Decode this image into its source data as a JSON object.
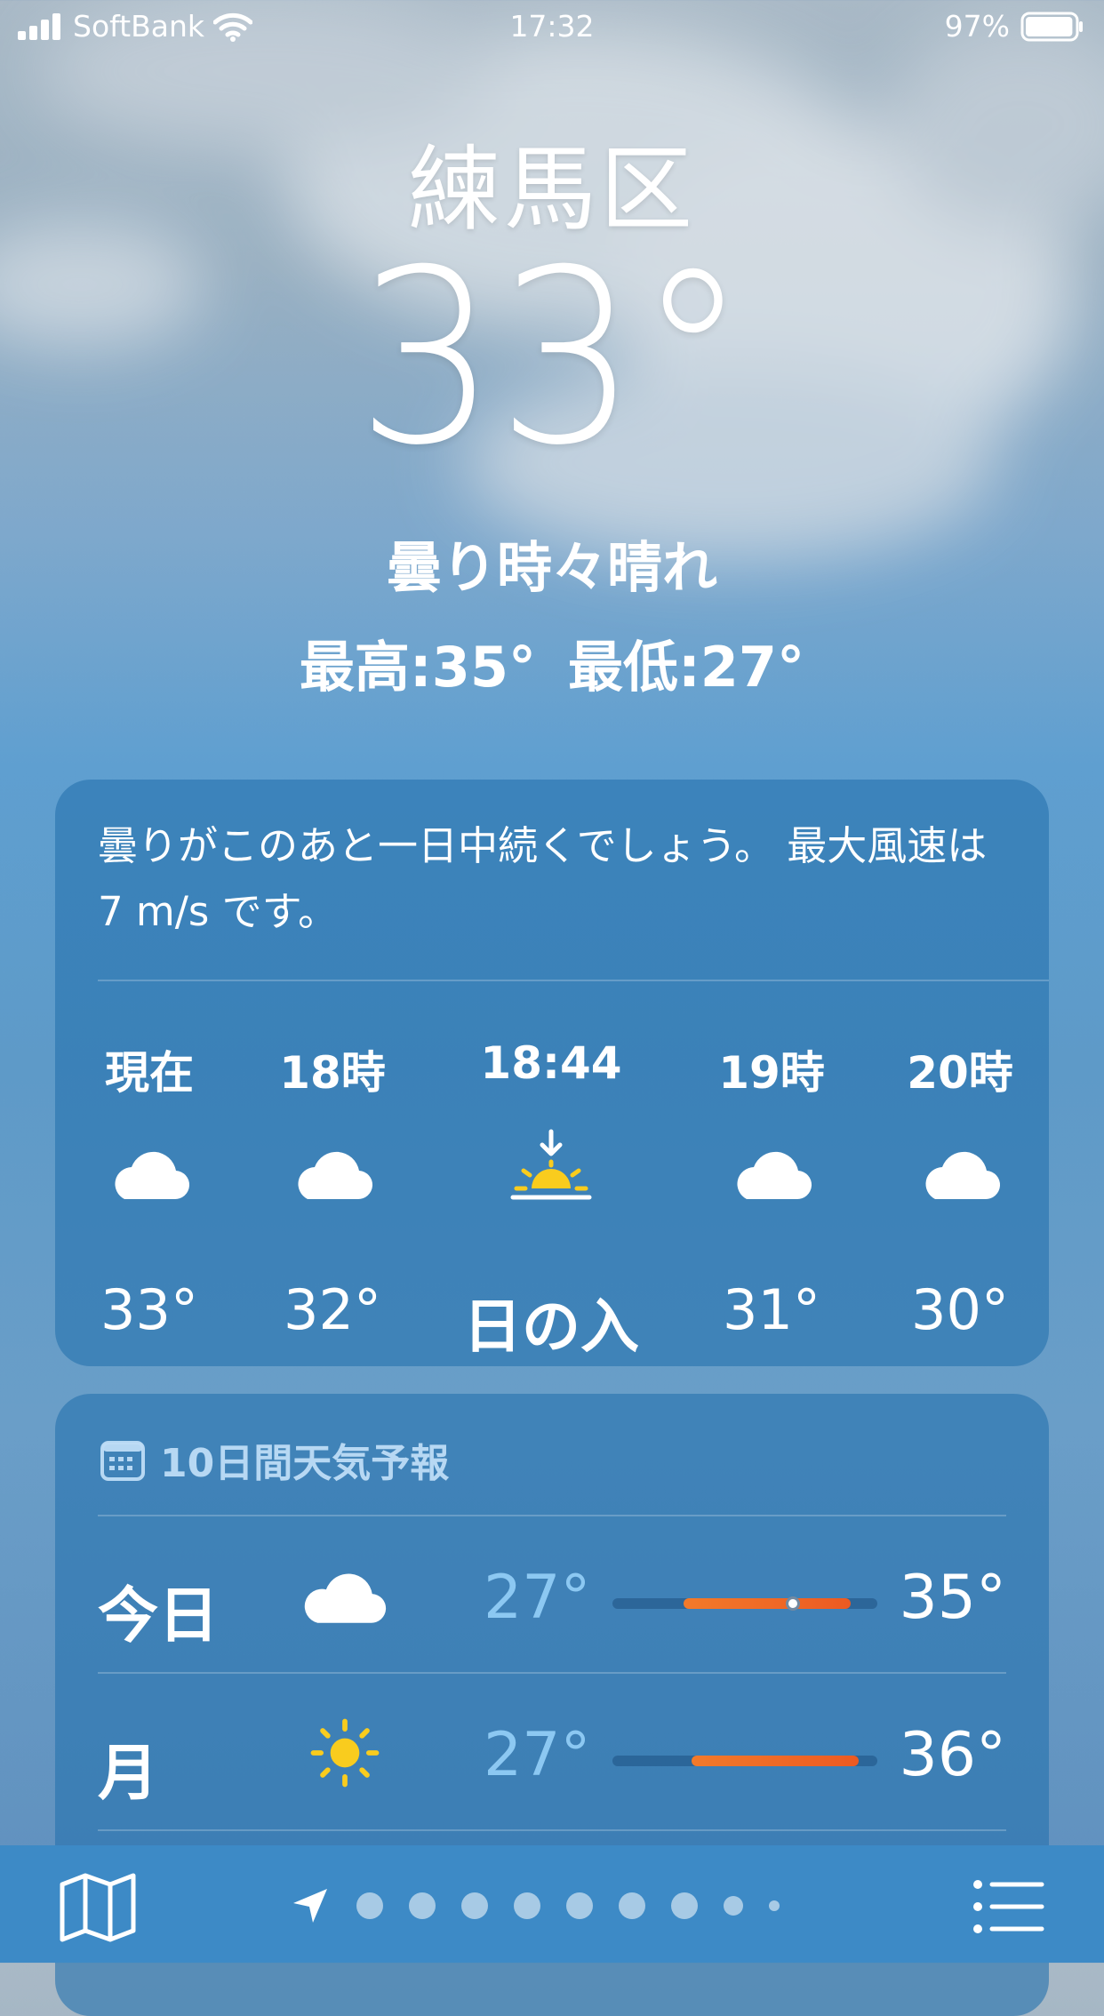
{
  "status_bar": {
    "carrier": "SoftBank",
    "time": "17:32",
    "battery": "97%"
  },
  "hero": {
    "city": "練馬区",
    "temperature": "33°",
    "condition": "曇り時々晴れ",
    "high": "最高:35°",
    "low": "最低:27°"
  },
  "hourly_card": {
    "summary": "曇りがこのあと一日中続くでしょう。 最大風速は 7 m/s です。",
    "hours": [
      {
        "label": "現在",
        "icon": "cloud-icon",
        "value": "33°"
      },
      {
        "label": "18時",
        "icon": "cloud-icon",
        "value": "32°"
      },
      {
        "label": "18:44",
        "icon": "sunset-icon",
        "value": "日の入"
      },
      {
        "label": "19時",
        "icon": "cloud-icon",
        "value": "31°"
      },
      {
        "label": "20時",
        "icon": "cloud-icon",
        "value": "30°"
      }
    ]
  },
  "forecast_card": {
    "title": "10日間天気予報",
    "icon": "calendar-icon",
    "days": [
      {
        "day": "今日",
        "icon": "cloud-icon",
        "low": "27°",
        "high": "35°",
        "range_start": 0.27,
        "range_end": 0.9,
        "current": 0.68
      },
      {
        "day": "月",
        "icon": "sun-icon",
        "low": "27°",
        "high": "36°",
        "range_start": 0.3,
        "range_end": 0.93
      }
    ]
  },
  "toolbar": {
    "page_count": 9,
    "active_page": 0,
    "icons": [
      "map-icon",
      "location-arrow-icon",
      "list-icon"
    ]
  },
  "colors": {
    "temp_bar": "#ec5a22",
    "low_temp": "#8cc8f2",
    "sun": "#f9cc1e"
  }
}
